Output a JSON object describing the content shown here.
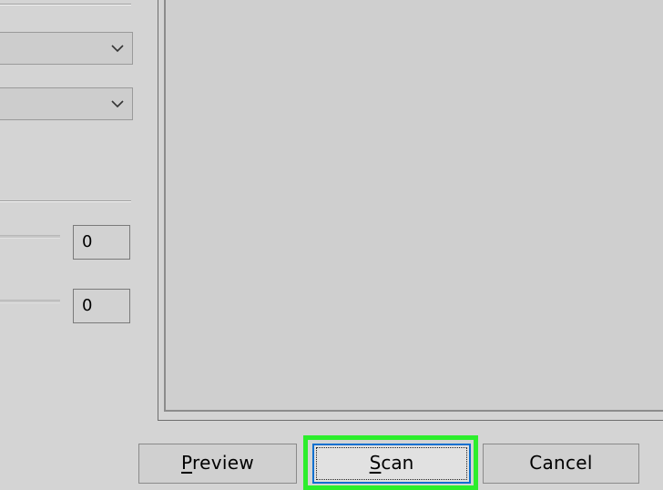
{
  "left_panel": {
    "combo_1": {
      "value": "",
      "icon": "chevron-down-icon"
    },
    "combo_2": {
      "value": "",
      "icon": "chevron-down-icon"
    },
    "brightness": {
      "value": "0"
    },
    "contrast": {
      "value": "0"
    }
  },
  "buttons": {
    "preview_label": "Preview",
    "preview_mnemonic": "P",
    "preview_rest": "review",
    "scan_label": "Scan",
    "scan_mnemonic": "S",
    "scan_rest": "can",
    "cancel_label": "Cancel"
  },
  "colors": {
    "background": "#d4d4d4",
    "highlight": "#2cee2c",
    "focus_border": "#0a6fcf"
  }
}
